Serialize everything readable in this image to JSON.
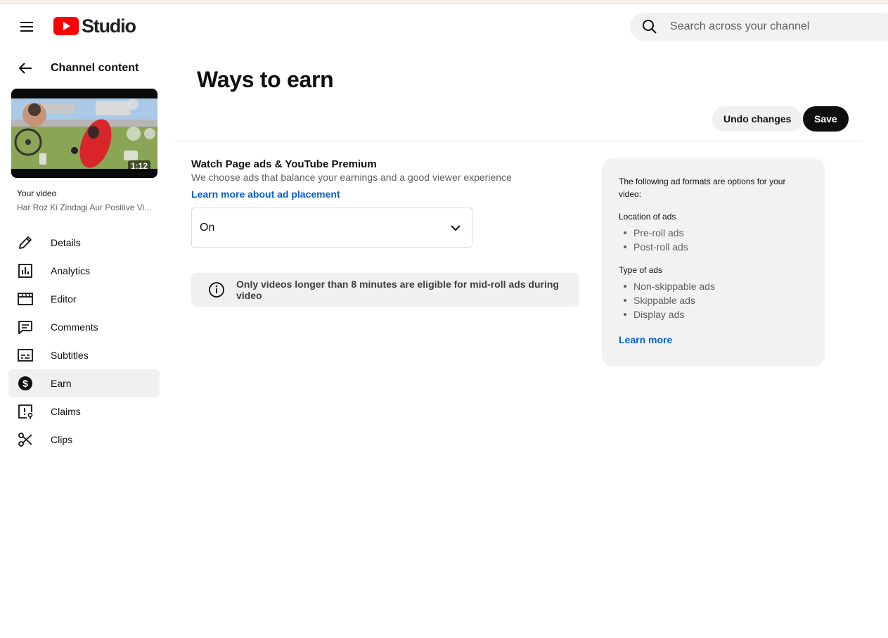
{
  "header": {
    "logo_text": "Studio",
    "search_placeholder": "Search across your channel"
  },
  "sidebar": {
    "back_title": "Channel content",
    "thumbnail_duration": "1:12",
    "your_video_label": "Your video",
    "video_title": "Har Roz Ki Zindagi Aur Positive Vi...",
    "items": [
      {
        "label": "Details",
        "icon": "pencil-icon"
      },
      {
        "label": "Analytics",
        "icon": "analytics-icon"
      },
      {
        "label": "Editor",
        "icon": "clapperboard-icon"
      },
      {
        "label": "Comments",
        "icon": "comment-icon"
      },
      {
        "label": "Subtitles",
        "icon": "subtitles-icon"
      },
      {
        "label": "Earn",
        "icon": "dollar-icon",
        "active": true
      },
      {
        "label": "Claims",
        "icon": "claims-icon"
      },
      {
        "label": "Clips",
        "icon": "scissors-icon"
      }
    ]
  },
  "main": {
    "title": "Ways to earn",
    "undo_label": "Undo changes",
    "save_label": "Save",
    "section": {
      "title": "Watch Page ads & YouTube Premium",
      "subtitle": "We choose ads that balance your earnings and a good viewer experience",
      "link": "Learn more about ad placement",
      "dropdown_value": "On"
    },
    "notice": "Only videos longer than 8 minutes are eligible for mid-roll ads during video"
  },
  "info_card": {
    "intro": "The following ad formats are options for your video:",
    "location_heading": "Location of ads",
    "location_items": [
      "Pre-roll ads",
      "Post-roll ads"
    ],
    "type_heading": "Type of ads",
    "type_items": [
      "Non-skippable ads",
      "Skippable ads",
      "Display ads"
    ],
    "learn_more": "Learn more"
  },
  "colors": {
    "accent_link": "#065fd4",
    "logo_red": "#ff0000",
    "save_bg": "#0f0f0f"
  }
}
